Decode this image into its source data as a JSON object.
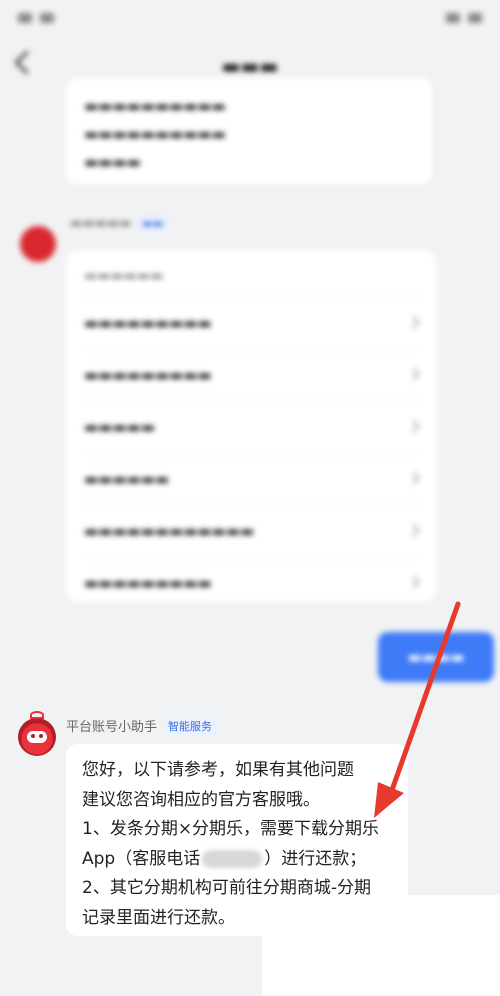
{
  "sender": {
    "name": "平台账号小助手",
    "tag": "智能服务"
  },
  "answer": {
    "lines": [
      "您好，以下请参考，如果有其他问题",
      "建议您咨询相应的官方客服哦。",
      "1、发条分期×分期乐，需要下载分期乐",
      "App（客服电话",
      "）进行还款；",
      "2、其它分期机构可前往分期商城-分期",
      "记录里面进行还款。"
    ]
  },
  "colors": {
    "arrow": "#e8392d",
    "user_bubble": "#3d7bf7",
    "tag_text": "#3a6fe0",
    "avatar": "#e8333c"
  }
}
